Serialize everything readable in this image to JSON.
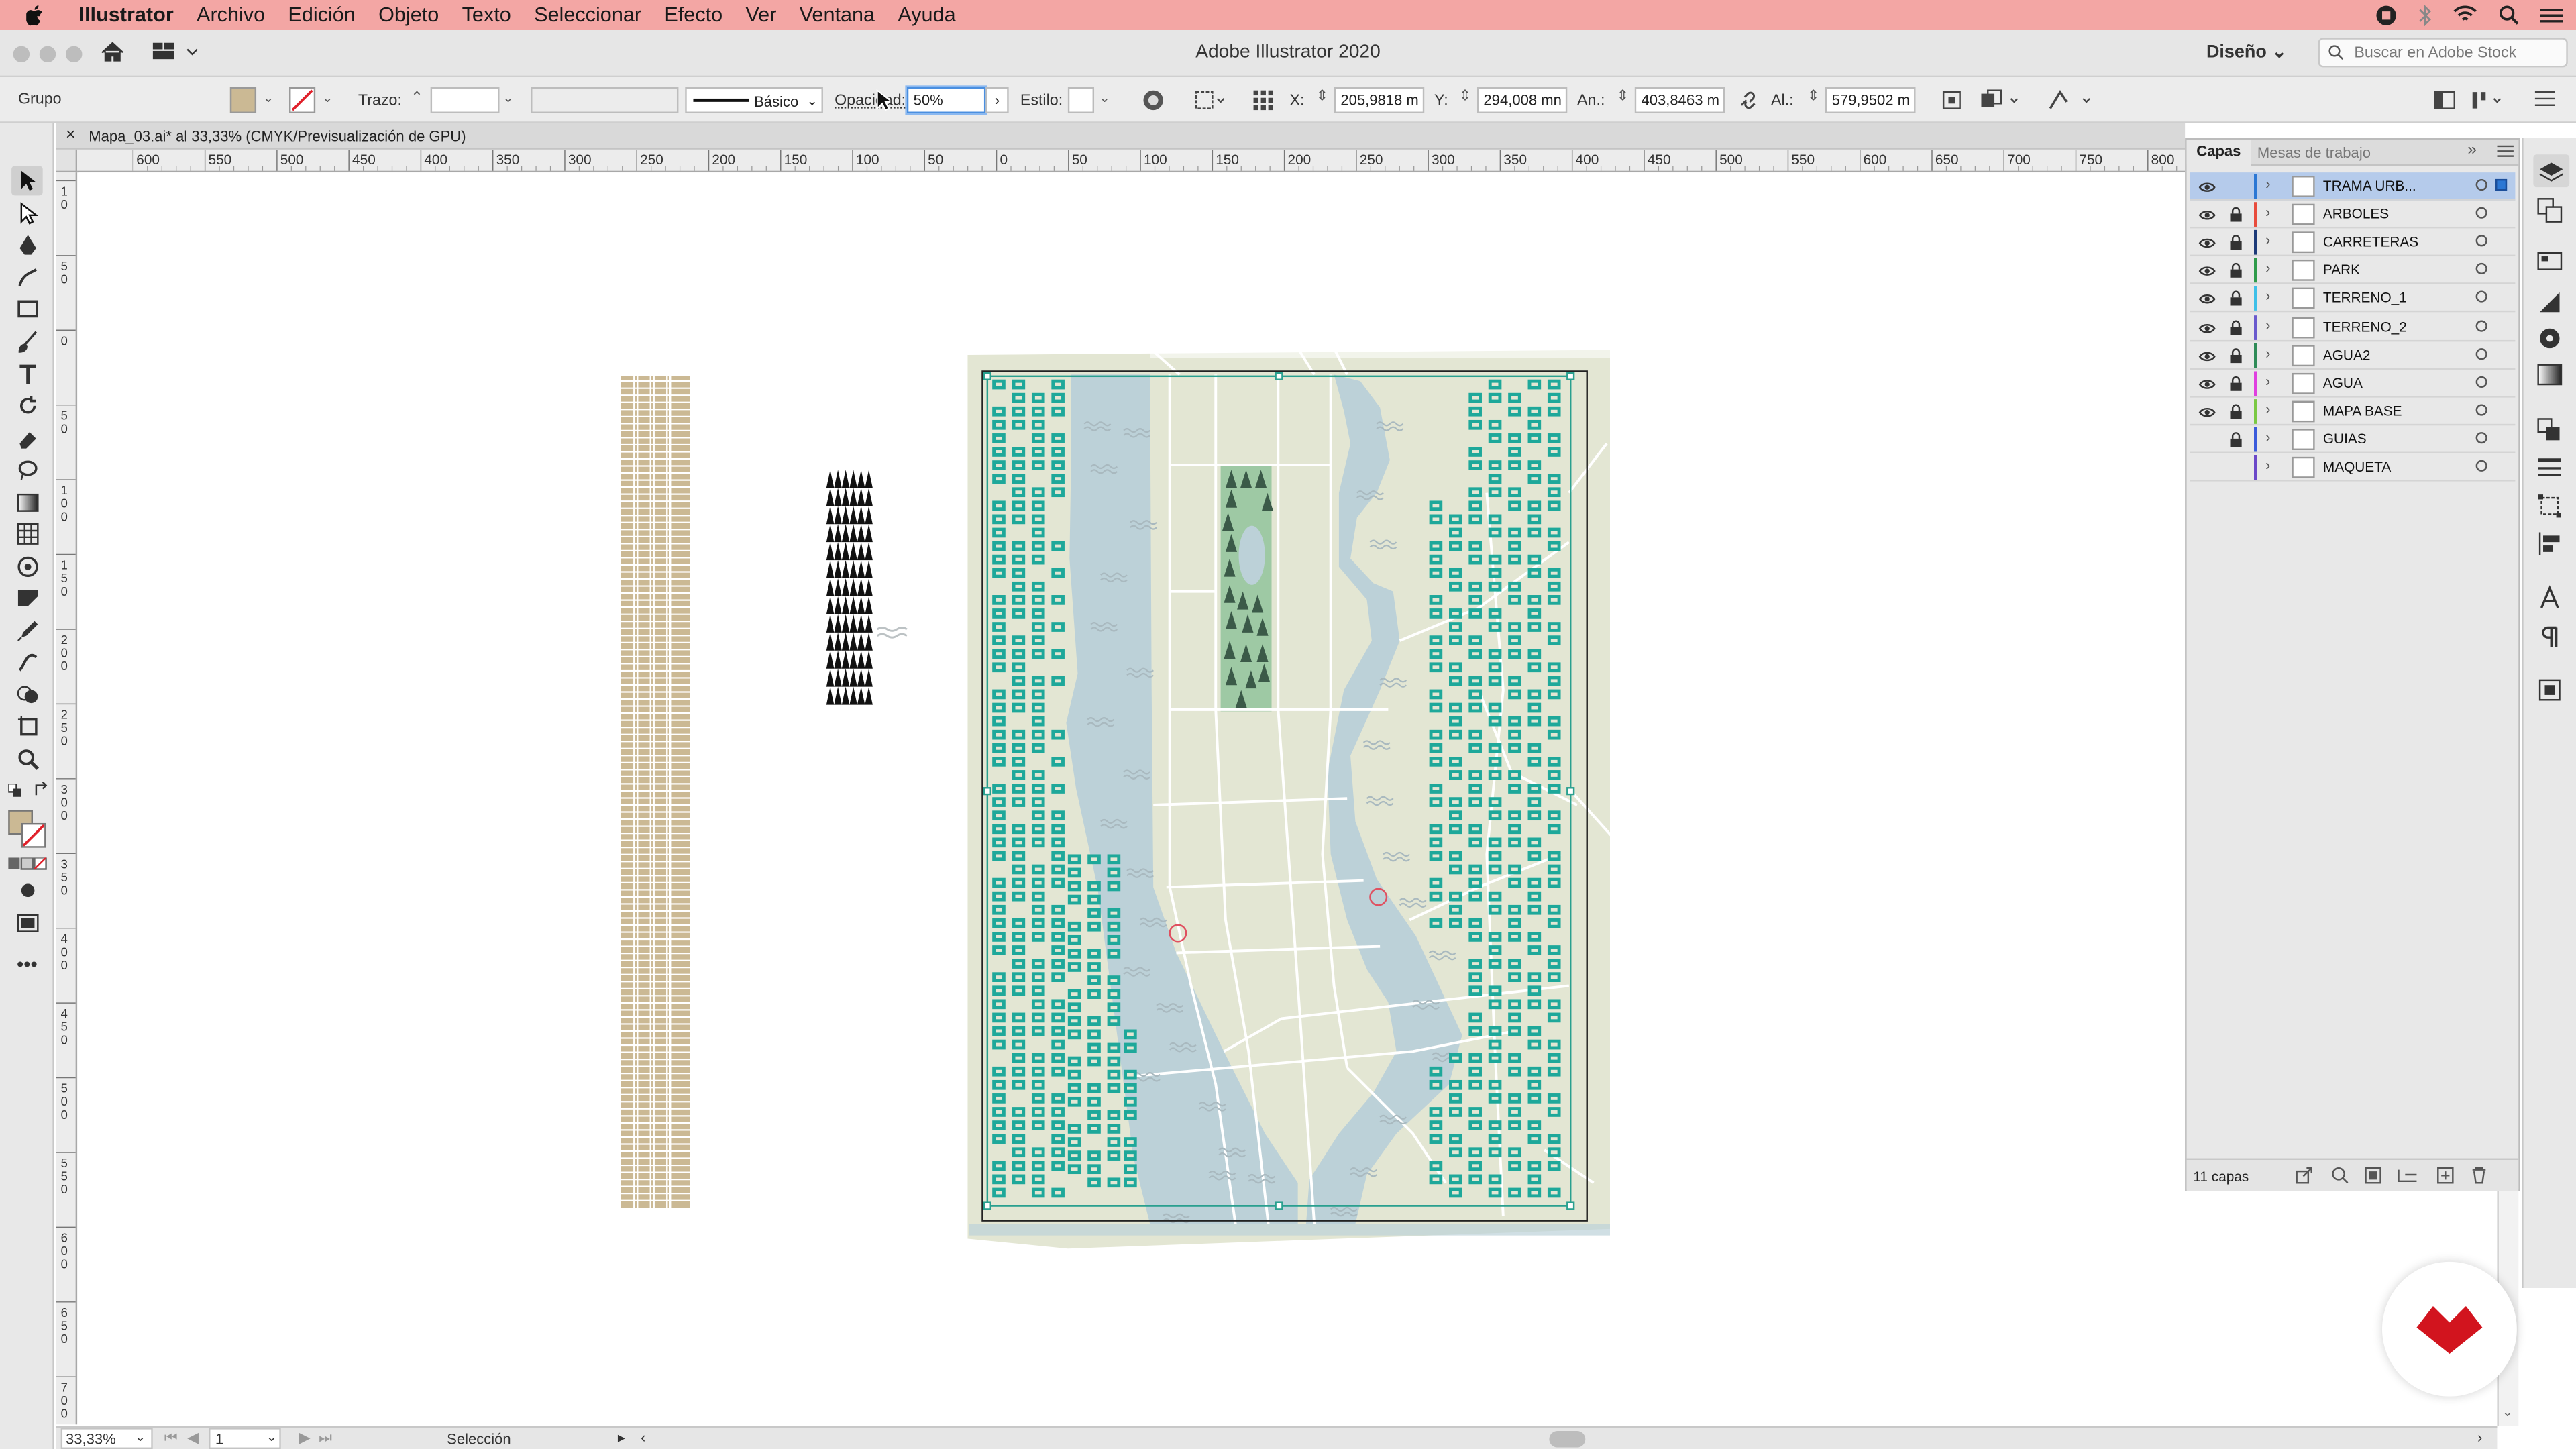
{
  "menubar": {
    "app_name": "Illustrator",
    "items": [
      "Archivo",
      "Edición",
      "Objeto",
      "Texto",
      "Seleccionar",
      "Efecto",
      "Ver",
      "Ventana",
      "Ayuda"
    ]
  },
  "titlebar": {
    "title": "Adobe Illustrator 2020",
    "workspace": "Diseño",
    "search_placeholder": "Buscar en Adobe Stock"
  },
  "control_bar": {
    "selection_type": "Grupo",
    "stroke_label": "Trazo:",
    "brush_label": "Básico",
    "opacity_label": "Opacidad:",
    "opacity_value": "50%",
    "style_label": "Estilo:",
    "x_label": "X:",
    "x_value": "205,9818 m",
    "y_label": "Y:",
    "y_value": "294,008 mn",
    "width_label": "An.:",
    "width_value": "403,8463 m",
    "height_label": "Al.:",
    "height_value": "579,9502 m"
  },
  "document_tab": {
    "title": "Mapa_03.ai* al 33,33% (CMYK/Previsualización de GPU)"
  },
  "ruler": {
    "horizontal_ticks": [
      "600",
      "550",
      "500",
      "450",
      "400",
      "350",
      "300",
      "250",
      "200",
      "150",
      "100",
      "50",
      "0",
      "50",
      "100",
      "150",
      "200",
      "250",
      "300",
      "350",
      "400",
      "450",
      "500",
      "550",
      "600",
      "650",
      "700",
      "750",
      "800"
    ],
    "vertical_ticks": [
      "1 0",
      "5 0",
      "0",
      "5 0",
      "1 0 0",
      "1 5 0",
      "2 0 0",
      "2 5 0",
      "3 0 0",
      "3 5 0",
      "4 0 0",
      "4 5 0",
      "5 0 0",
      "5 5 0",
      "6 0 0",
      "6 5 0",
      "7 0 0"
    ]
  },
  "status_bar": {
    "zoom": "33,33%",
    "artboard": "1",
    "tool": "Selección"
  },
  "layers_panel": {
    "tabs": [
      "Capas",
      "Mesas de trabajo"
    ],
    "layers": [
      {
        "name": "TRAMA URB...",
        "color": "#2b77d4",
        "visible": true,
        "locked": false,
        "selected": true
      },
      {
        "name": "ARBOLES",
        "color": "#e84c3d",
        "visible": true,
        "locked": true,
        "selected": false
      },
      {
        "name": "CARRETERAS",
        "color": "#1d3a78",
        "visible": true,
        "locked": true,
        "selected": false
      },
      {
        "name": "PARK",
        "color": "#2e9b4a",
        "visible": true,
        "locked": true,
        "selected": false
      },
      {
        "name": "TERRENO_1",
        "color": "#3ec0e8",
        "visible": true,
        "locked": true,
        "selected": false
      },
      {
        "name": "TERRENO_2",
        "color": "#6a5acd",
        "visible": true,
        "locked": true,
        "selected": false
      },
      {
        "name": "AGUA2",
        "color": "#2e8b57",
        "visible": true,
        "locked": true,
        "selected": false
      },
      {
        "name": "AGUA",
        "color": "#e040e0",
        "visible": true,
        "locked": true,
        "selected": false
      },
      {
        "name": "MAPA BASE",
        "color": "#7ac943",
        "visible": true,
        "locked": true,
        "selected": false
      },
      {
        "name": "GUIAS",
        "color": "#3b5bdb",
        "visible": false,
        "locked": true,
        "selected": false
      },
      {
        "name": "MAQUETA",
        "color": "#6b48c8",
        "visible": false,
        "locked": false,
        "selected": false
      }
    ],
    "count": "11 capas"
  },
  "colors": {
    "menubar_bg": "#f3a6a4",
    "map_land": "#e3e6d3",
    "map_water": "#bcd1d8",
    "park": "#9ec9a4",
    "buildings": "#1ea89a",
    "selection": "#2aa08f",
    "building_swatch": "#cbb994"
  }
}
